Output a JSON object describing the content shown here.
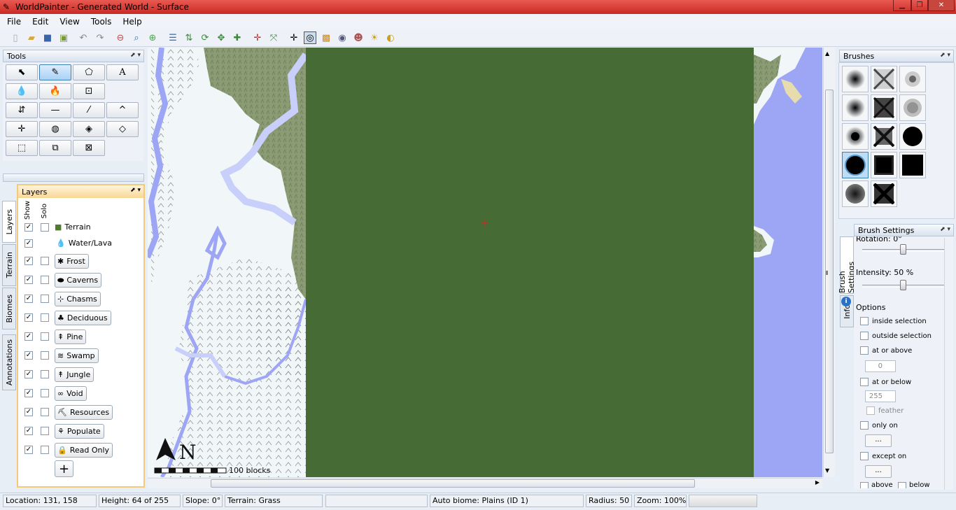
{
  "window": {
    "title": "WorldPainter - Generated World - Surface"
  },
  "menu": [
    "File",
    "Edit",
    "View",
    "Tools",
    "Help"
  ],
  "panels": {
    "tools": "Tools",
    "layers": "Layers",
    "brushes": "Brushes",
    "brush_settings": "Brush Settings"
  },
  "layers": {
    "col_show": "Show",
    "col_solo": "Solo",
    "items": [
      {
        "label": "Terrain",
        "icon": "grass-block-icon",
        "show": true,
        "solo_box": true
      },
      {
        "label": "Water/Lava",
        "icon": "water-drop-icon",
        "show": true,
        "solo_box": false
      },
      {
        "label": "Frost",
        "icon": "snowflake-icon",
        "show": true,
        "solo_box": true
      },
      {
        "label": "Caverns",
        "icon": "caverns-icon",
        "show": true,
        "solo_box": true
      },
      {
        "label": "Chasms",
        "icon": "chasms-icon",
        "show": true,
        "solo_box": true
      },
      {
        "label": "Deciduous",
        "icon": "deciduous-tree-icon",
        "show": true,
        "solo_box": true
      },
      {
        "label": "Pine",
        "icon": "pine-tree-icon",
        "show": true,
        "solo_box": true
      },
      {
        "label": "Swamp",
        "icon": "swamp-icon",
        "show": true,
        "solo_box": true
      },
      {
        "label": "Jungle",
        "icon": "jungle-icon",
        "show": true,
        "solo_box": true
      },
      {
        "label": "Void",
        "icon": "infinity-icon",
        "show": true,
        "solo_box": true
      },
      {
        "label": "Resources",
        "icon": "resources-icon",
        "show": true,
        "solo_box": true
      },
      {
        "label": "Populate",
        "icon": "populate-icon",
        "show": true,
        "solo_box": true
      },
      {
        "label": "Read Only",
        "icon": "lock-icon",
        "show": true,
        "solo_box": true
      }
    ],
    "add_label": "+"
  },
  "side_tabs": [
    "Layers",
    "Terrain",
    "Biomes",
    "Annotations"
  ],
  "brush_tabs": [
    "Brush Settings",
    "Info"
  ],
  "brush_settings": {
    "rotation_label": "Rotation: 0°",
    "rotation_fraction": 0.5,
    "intensity_label": "Intensity: 50 %",
    "intensity_fraction": 0.5,
    "options_label": "Options",
    "inside_selection": "inside selection",
    "outside_selection": "outside selection",
    "at_or_above": "at or above",
    "above_value": "0",
    "at_or_below": "at or below",
    "below_value": "255",
    "feather": "feather",
    "only_on": "only on",
    "except_on": "except on",
    "ellipsis": "...",
    "cut_above": "above",
    "cut_below": "below"
  },
  "map": {
    "scale_label": "100 blocks",
    "north_label": "N"
  },
  "status": {
    "location": "Location: 131, 158",
    "height": "Height: 64 of 255",
    "slope": "Slope: 0°",
    "terrain": "Terrain: Grass",
    "blank": "",
    "biome": "Auto biome: Plains (ID 1)",
    "radius": "Radius: 50",
    "zoom": "Zoom: 100%"
  },
  "colors": {
    "grass": "#466b35",
    "snow": "#f1f6f9",
    "water": "#9da5f5",
    "forest": "#8c9d75",
    "title": "#d63a33"
  }
}
